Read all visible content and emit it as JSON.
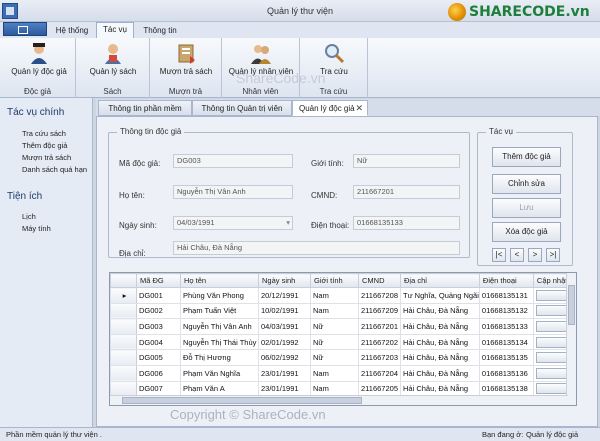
{
  "window": {
    "title": "Quản lý thư viện"
  },
  "watermark": {
    "logo_text": "SHARECODE.vn",
    "mid_text": "ShareCode.vn",
    "bottom_text": "Copyright © ShareCode.vn"
  },
  "ribbon_tabs": [
    "Hệ thống",
    "Tác vụ",
    "Thông tin"
  ],
  "ribbon": {
    "buttons": [
      "Quản lý độc giả",
      "Quản lý sách",
      "Mượn trả sách",
      "Quản lý nhân viên",
      "Tra cứu"
    ],
    "groups": [
      "Độc giả",
      "Sách",
      "Mượn trả",
      "Nhân viên",
      "Tra cứu"
    ]
  },
  "left_pane": {
    "section1": "Tác vụ chính",
    "items1": [
      "Tra cứu sách",
      "Thêm độc giả",
      "Mượn trả sách",
      "Danh sách quá hạn"
    ],
    "section2": "Tiện ích",
    "items2": [
      "Lịch",
      "Máy tính"
    ]
  },
  "doc_tabs": [
    "Thông tin phần mềm",
    "Thông tin Quản trị viên",
    "Quản lý độc giả"
  ],
  "form": {
    "legend": "Thông tin độc giả",
    "labels": {
      "ma": "Mã độc giả:",
      "ten": "Họ tên:",
      "ngaysinh": "Ngày sinh:",
      "diachi": "Địa chỉ:",
      "gioitinh": "Giới tính:",
      "cmnd": "CMND:",
      "dienthoai": "Điện thoại:"
    },
    "values": {
      "ma": "DG003",
      "ten": "Nguyễn Thị Vân Anh",
      "ngaysinh": "04/03/1991",
      "diachi": "Hải Châu, Đà Nẵng",
      "gioitinh": "Nữ",
      "cmnd": "211667201",
      "dienthoai": "01668135133"
    }
  },
  "actions": {
    "legend": "Tác vụ",
    "buttons": [
      "Thêm độc giả",
      "Chỉnh sửa",
      "Lưu",
      "Xóa độc giả"
    ],
    "nav": [
      "|<",
      "<",
      ">",
      ">|"
    ]
  },
  "grid": {
    "columns": [
      "Mã ĐG",
      "Họ tên",
      "Ngày sinh",
      "Giới tính",
      "CMND",
      "Địa chỉ",
      "Điện thoại",
      "Cập nhật"
    ],
    "rows": [
      [
        "DG001",
        "Phùng Văn Phong",
        "20/12/1991",
        "Nam",
        "211667208",
        "Tư Nghĩa, Quảng Ngãi",
        "01668135131"
      ],
      [
        "DG002",
        "Phạm Tuấn Việt",
        "10/02/1991",
        "Nam",
        "211667209",
        "Hải Châu, Đà Nẵng",
        "01668135132"
      ],
      [
        "DG003",
        "Nguyễn Thị Vân Anh",
        "04/03/1991",
        "Nữ",
        "211667201",
        "Hải Châu, Đà Nẵng",
        "01668135133"
      ],
      [
        "DG004",
        "Nguyễn Thị Thái Thủy",
        "02/01/1992",
        "Nữ",
        "211667202",
        "Hải Châu, Đà Nẵng",
        "01668135134"
      ],
      [
        "DG005",
        "Đỗ Thị Hương",
        "06/02/1992",
        "Nữ",
        "211667203",
        "Hải Châu, Đà Nẵng",
        "01668135135"
      ],
      [
        "DG006",
        "Phạm Văn Nghĩa",
        "23/01/1991",
        "Nam",
        "211667204",
        "Hải Châu, Đà Nẵng",
        "01668135136"
      ],
      [
        "DG007",
        "Phạm Văn A",
        "23/01/1991",
        "Nam",
        "211667205",
        "Hải Châu, Đà Nẵng",
        "01668135138"
      ]
    ]
  },
  "status": {
    "left": "Phần mềm quản lý thư viện .",
    "right_label": "Bạn đang ở:",
    "right_value": "Quản lý độc giả"
  }
}
